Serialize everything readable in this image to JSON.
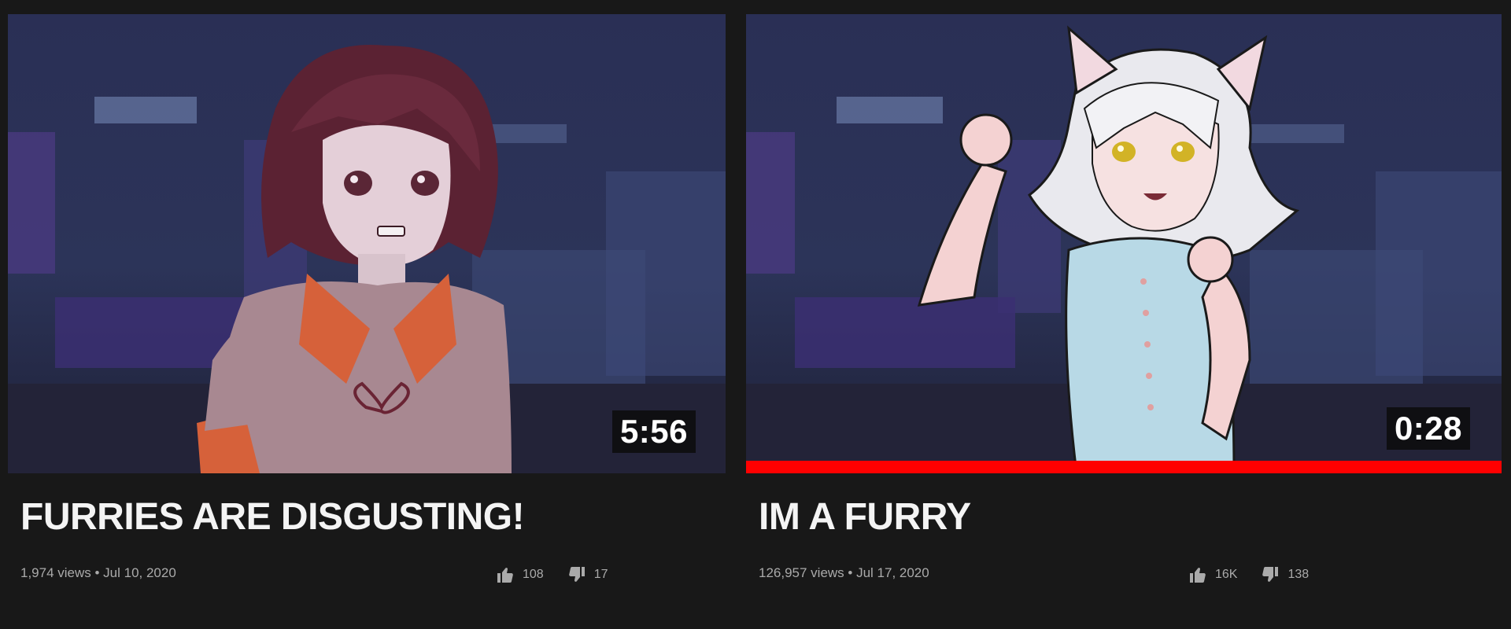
{
  "videos": [
    {
      "title": "FURRIES ARE DISGUSTING!",
      "duration": "5:56",
      "views": "1,974 views",
      "date": "Jul 10, 2020",
      "meta": "1,974 views • Jul 10, 2020",
      "likes": "108",
      "dislikes": "17",
      "watched_fraction": 0,
      "like_icon": "thumbs-up-icon",
      "dislike_icon": "thumbs-down-icon"
    },
    {
      "title": "IM A FURRY",
      "duration": "0:28",
      "views": "126,957 views",
      "date": "Jul 17, 2020",
      "meta": "126,957 views • Jul 17, 2020",
      "likes": "16K",
      "dislikes": "138",
      "watched_fraction": 1.0,
      "like_icon": "thumbs-up-icon",
      "dislike_icon": "thumbs-down-icon"
    }
  ],
  "colors": {
    "background": "#181818",
    "progress": "#ff0000",
    "meta_text": "#aaaaaa",
    "title_text": "#f4f4f4"
  }
}
